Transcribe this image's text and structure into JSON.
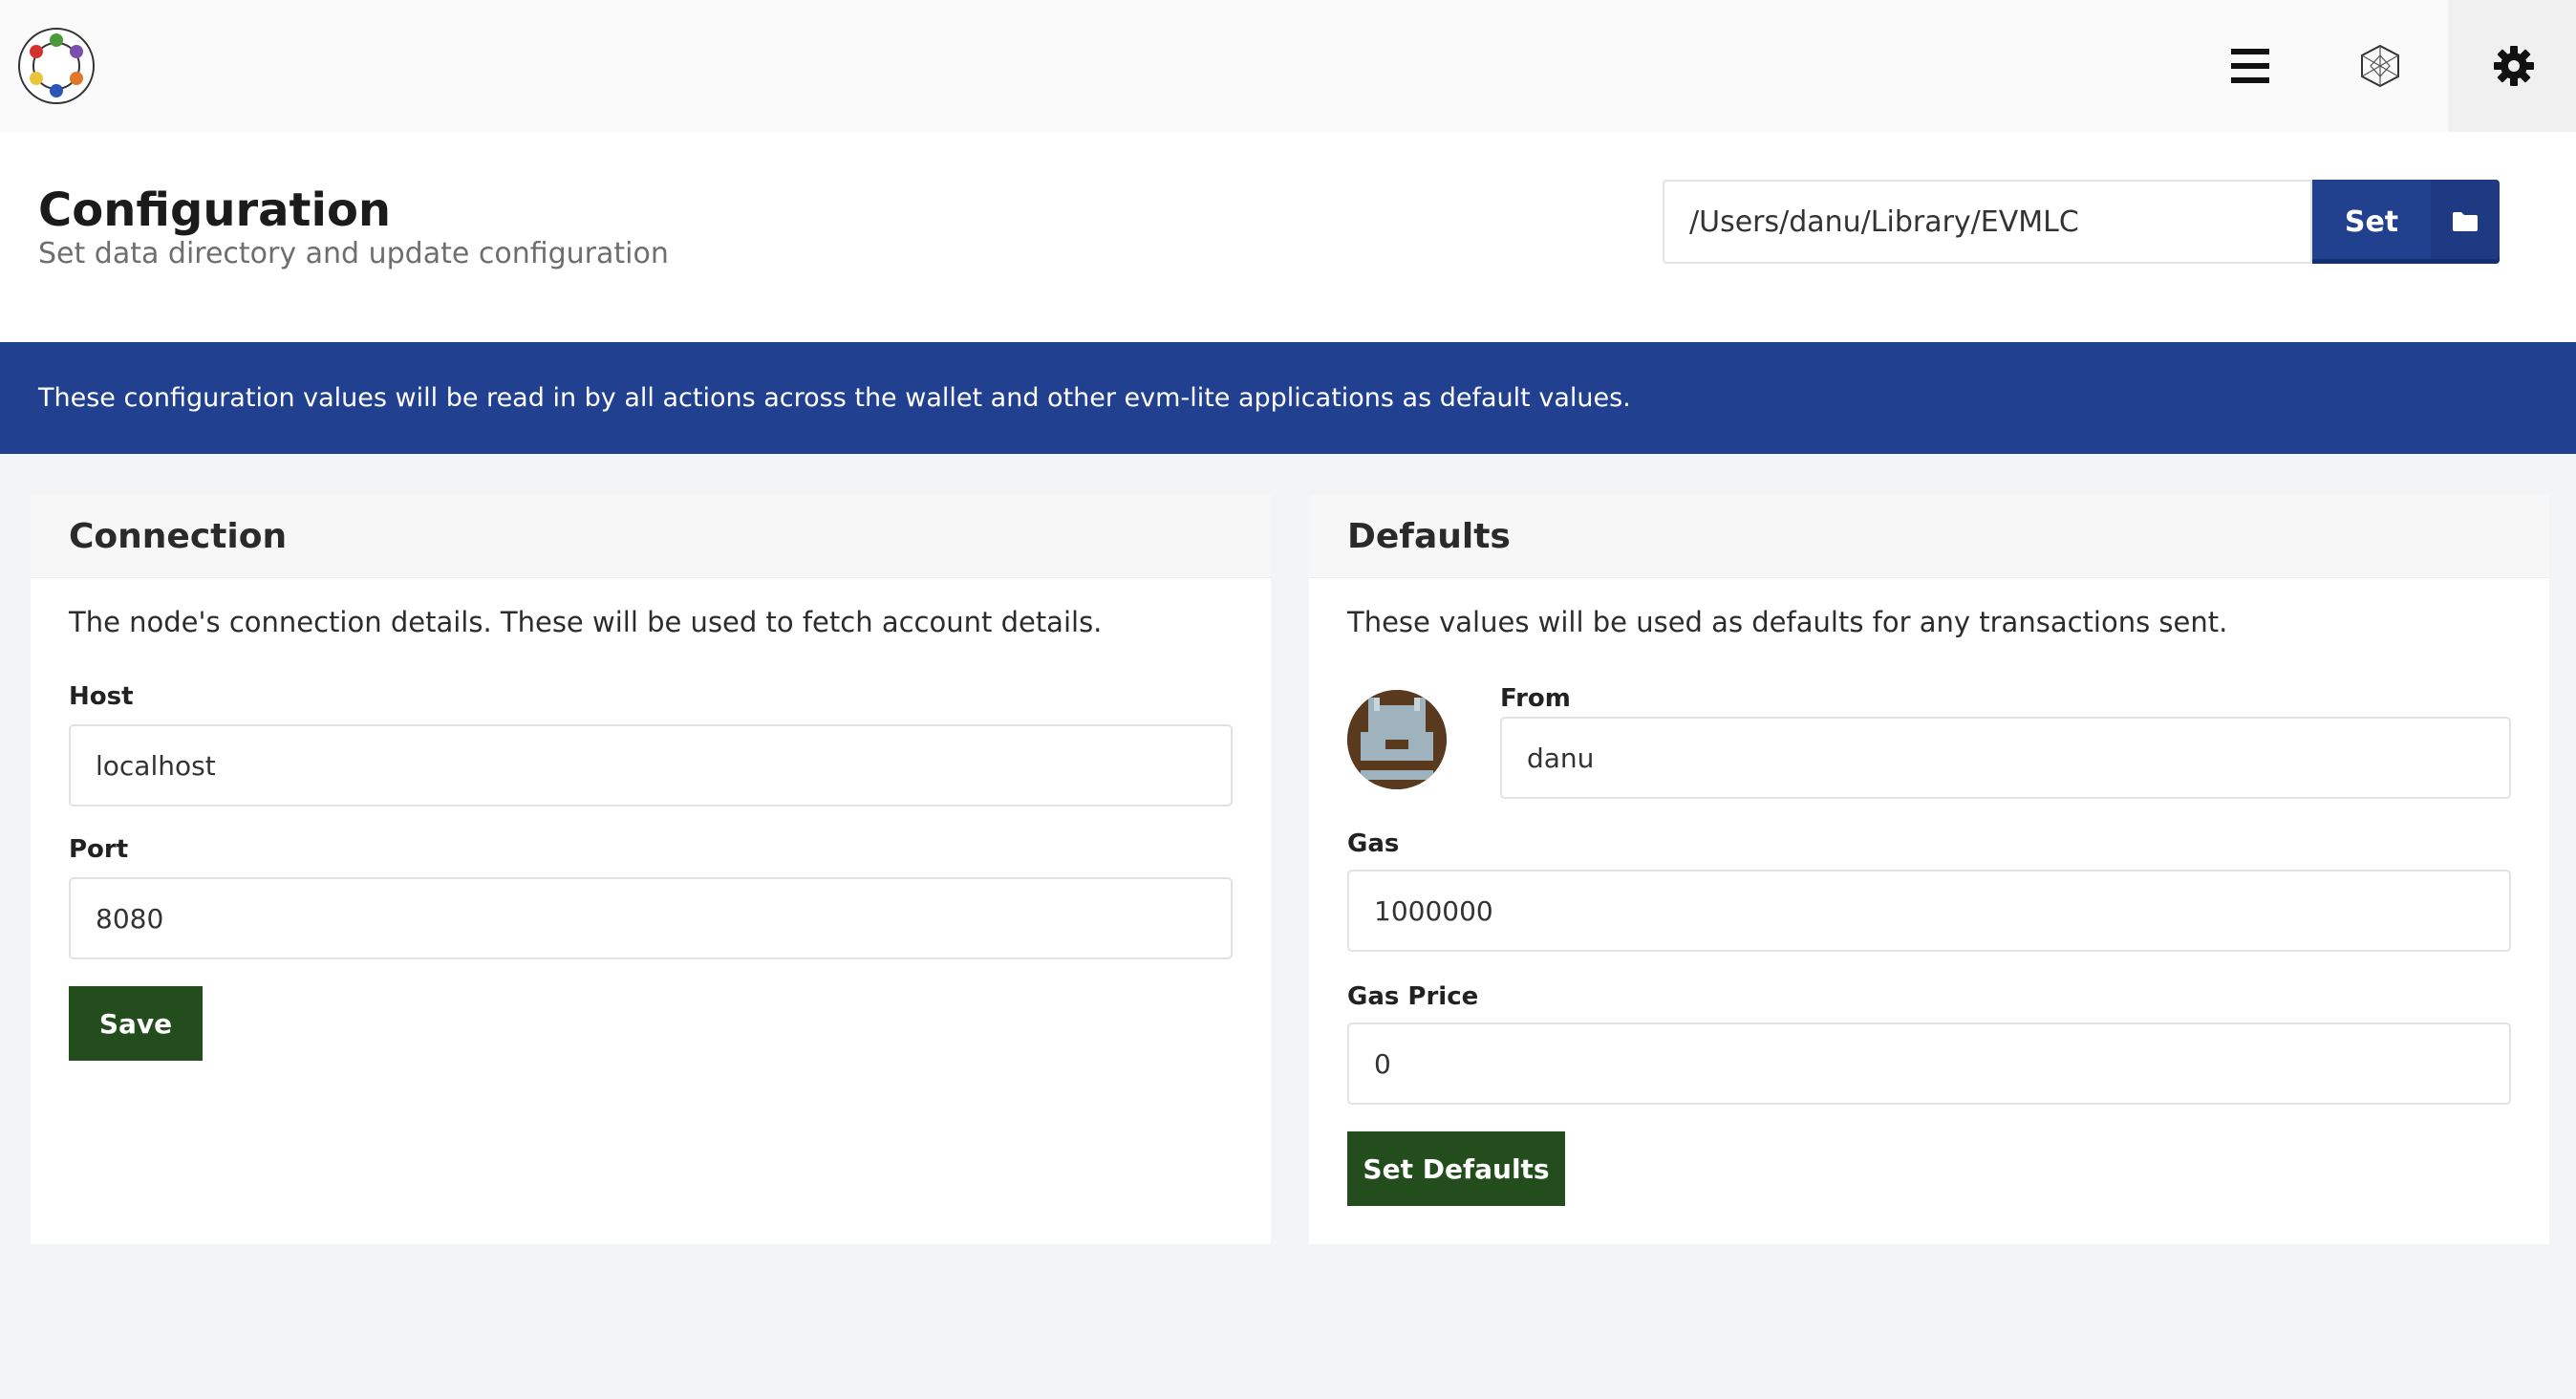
{
  "header": {
    "title": "Configuration",
    "subtitle": "Set data directory and update configuration",
    "data_directory": "/Users/danu/Library/EVMLC",
    "set_label": "Set"
  },
  "banner": {
    "text": "These configuration values will be read in by all actions across the wallet and other evm-lite applications as default values."
  },
  "connection": {
    "title": "Connection",
    "description": "The node's connection details. These will be used to fetch account details.",
    "host_label": "Host",
    "host_value": "localhost",
    "port_label": "Port",
    "port_value": "8080",
    "save_label": "Save"
  },
  "defaults": {
    "title": "Defaults",
    "description": "These values will be used as defaults for any transactions sent.",
    "from_label": "From",
    "from_value": "danu",
    "gas_label": "Gas",
    "gas_value": "1000000",
    "gas_price_label": "Gas Price",
    "gas_price_value": "0",
    "set_defaults_label": "Set Defaults"
  },
  "icons": {
    "menu": "hamburger-menu-icon",
    "network": "hexagon-network-icon",
    "settings": "gear-icon",
    "folder": "folder-icon",
    "logo": "bug-ring-logo"
  },
  "colors": {
    "primary_blue": "#214190",
    "action_green": "#234d1c",
    "page_bg": "#f3f4f6"
  }
}
